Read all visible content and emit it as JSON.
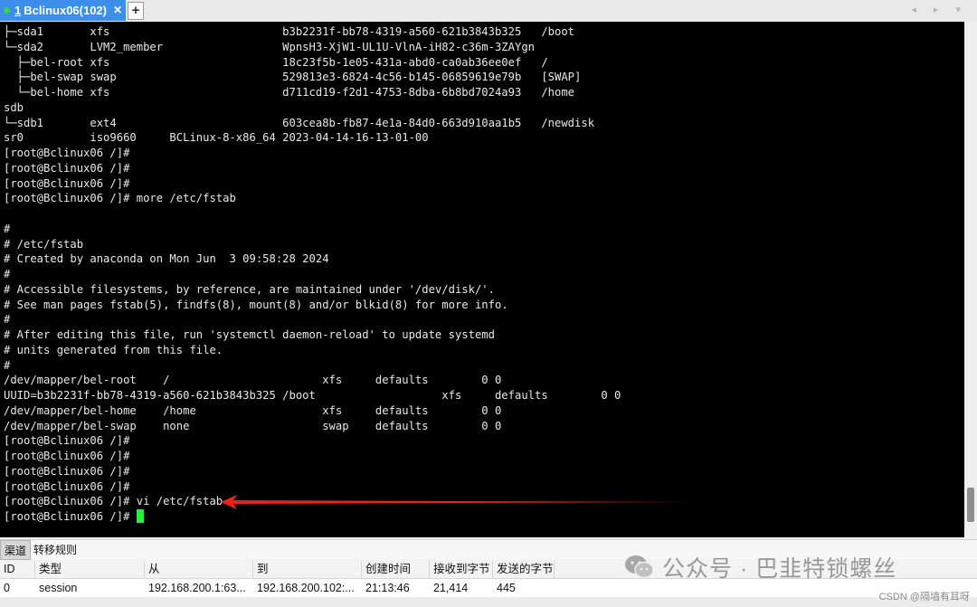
{
  "tabs": [
    {
      "index": "1",
      "label": "Bclinux06(102)",
      "status_color": "#33d35a"
    }
  ],
  "tab_bar": {
    "new_tab_symbol": "+",
    "nav_arrows": "◂ ▸ ▾"
  },
  "terminal": {
    "cursor_color": "#1df53c",
    "lines": [
      "├─sda1       xfs                          b3b2231f-bb78-4319-a560-621b3843b325   /boot",
      "└─sda2       LVM2_member                  WpnsH3-XjW1-UL1U-VlnA-iH82-c36m-3ZAYgn",
      "  ├─bel-root xfs                          18c23f5b-1e05-431a-abd0-ca0ab36ee0ef   /",
      "  ├─bel-swap swap                         529813e3-6824-4c56-b145-06859619e79b   [SWAP]",
      "  └─bel-home xfs                          d711cd19-f2d1-4753-8dba-6b8bd7024a93   /home",
      "sdb",
      "└─sdb1       ext4                         603cea8b-fb87-4e1a-84d0-663d910aa1b5   /newdisk",
      "sr0          iso9660     BCLinux-8-x86_64 2023-04-14-16-13-01-00",
      "[root@Bclinux06 /]#",
      "[root@Bclinux06 /]#",
      "[root@Bclinux06 /]#",
      "[root@Bclinux06 /]# more /etc/fstab",
      "",
      "#",
      "# /etc/fstab",
      "# Created by anaconda on Mon Jun  3 09:58:28 2024",
      "#",
      "# Accessible filesystems, by reference, are maintained under '/dev/disk/'.",
      "# See man pages fstab(5), findfs(8), mount(8) and/or blkid(8) for more info.",
      "#",
      "# After editing this file, run 'systemctl daemon-reload' to update systemd",
      "# units generated from this file.",
      "#",
      "/dev/mapper/bel-root    /                       xfs     defaults        0 0",
      "UUID=b3b2231f-bb78-4319-a560-621b3843b325 /boot                   xfs     defaults        0 0",
      "/dev/mapper/bel-home    /home                   xfs     defaults        0 0",
      "/dev/mapper/bel-swap    none                    swap    defaults        0 0",
      "[root@Bclinux06 /]#",
      "[root@Bclinux06 /]#",
      "[root@Bclinux06 /]#",
      "[root@Bclinux06 /]#",
      "[root@Bclinux06 /]# vi /etc/fstab",
      "[root@Bclinux06 /]# "
    ]
  },
  "annotation": {
    "arrow_color": "#e8231c"
  },
  "panel": {
    "tabs": [
      {
        "label": "渠道",
        "active": true
      },
      {
        "label": "转移规则",
        "active": false
      }
    ],
    "columns": [
      "ID",
      "类型",
      "从",
      "到",
      "创建时间",
      "接收到字节",
      "发送的字节"
    ],
    "rows": [
      [
        "0",
        "session",
        "192.168.200.1:63...",
        "192.168.200.102:...",
        "21:13:46",
        "21,414",
        "445"
      ]
    ]
  },
  "watermark": {
    "text": "公众号 · 巴韭特锁螺丝",
    "logo_icon": "wechat-icon"
  },
  "credit": "CSDN @隔墙有耳呀"
}
